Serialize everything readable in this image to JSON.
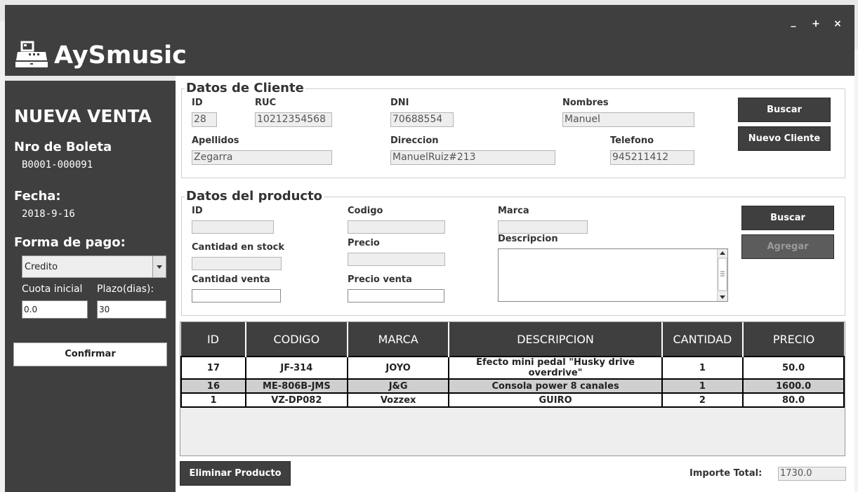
{
  "window": {
    "controls": {
      "minimize": "_",
      "maximize": "+",
      "close": "×"
    },
    "title": "AySmusic",
    "icon": "cash-register-icon"
  },
  "sidebar": {
    "heading": "NUEVA VENTA",
    "receipt_label": "Nro de Boleta",
    "receipt_value": "B0001-000091",
    "date_label": "Fecha:",
    "date_value": "2018-9-16",
    "payment_label": "Forma de pago:",
    "payment_selected": "Credito",
    "initial_fee_label": "Cuota inicial",
    "initial_fee_value": "0.0",
    "term_label": "Plazo(dias):",
    "term_value": "30",
    "confirm_label": "Confirmar"
  },
  "client": {
    "title": "Datos de Cliente",
    "id_label": "ID",
    "id_value": "28",
    "ruc_label": "RUC",
    "ruc_value": "10212354568",
    "dni_label": "DNI",
    "dni_value": "70688554",
    "names_label": "Nombres",
    "names_value": "Manuel",
    "surnames_label": "Apellidos",
    "surnames_value": "Zegarra",
    "address_label": "Direccion",
    "address_value": "ManuelRuiz#213",
    "phone_label": "Telefono",
    "phone_value": "945211412",
    "search_label": "Buscar",
    "new_client_label": "Nuevo Cliente"
  },
  "product": {
    "title": "Datos del producto",
    "id_label": "ID",
    "id_value": "",
    "code_label": "Codigo",
    "code_value": "",
    "brand_label": "Marca",
    "brand_value": "",
    "stock_label": "Cantidad en stock",
    "stock_value": "",
    "price_label": "Precio",
    "price_value": "",
    "description_label": "Descripcion",
    "description_value": "",
    "sale_qty_label": "Cantidad venta",
    "sale_qty_value": "",
    "sale_price_label": "Precio venta",
    "sale_price_value": "",
    "search_label": "Buscar",
    "add_label": "Agregar"
  },
  "table": {
    "headers": [
      "ID",
      "CODIGO",
      "MARCA",
      "DESCRIPCION",
      "CANTIDAD",
      "PRECIO"
    ],
    "rows": [
      [
        "17",
        "JF-314",
        "JOYO",
        "Efecto mini pedal \"Husky drive overdrive\"",
        "1",
        "50.0"
      ],
      [
        "16",
        "ME-806B-JMS",
        "J&G",
        "Consola power 8 canales",
        "1",
        "1600.0"
      ],
      [
        "1",
        "VZ-DP082",
        "Vozzex",
        "GUIRO",
        "2",
        "80.0"
      ]
    ]
  },
  "footer": {
    "delete_label": "Eliminar Producto",
    "total_label": "Importe Total:",
    "total_value": "1730.0"
  },
  "colors": {
    "dark": "#3f3f3f",
    "accent_row": "#cfcfcf"
  }
}
